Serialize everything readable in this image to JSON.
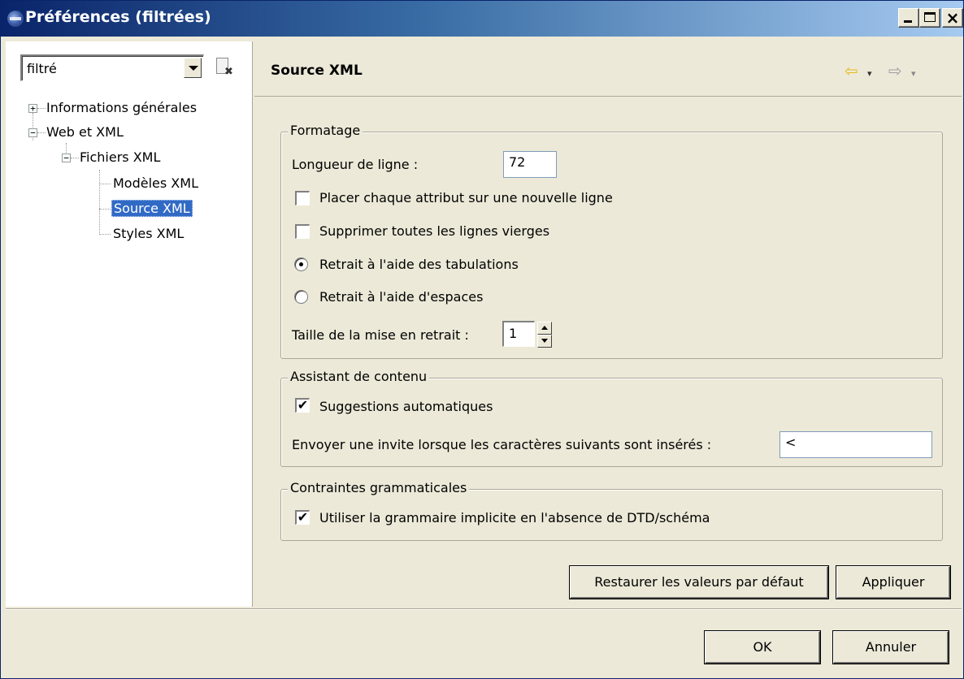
{
  "window": {
    "title": "Préférences (filtrées)",
    "controls": {
      "minimize": "_",
      "maximize": "□",
      "close": "×"
    }
  },
  "filter": {
    "value": "filtré"
  },
  "tree": {
    "items": [
      {
        "label": "Informations générales",
        "expander": "+"
      },
      {
        "label": "Web et XML",
        "expander": "−"
      },
      {
        "label": "Fichiers XML",
        "expander": "−"
      },
      {
        "label": "Modèles XML"
      },
      {
        "label": "Source XML",
        "selected": true
      },
      {
        "label": "Styles XML"
      }
    ]
  },
  "page": {
    "title": "Source XML",
    "nav": {
      "back": "⇦",
      "dropdown": "▾",
      "forward": "⇨"
    }
  },
  "formatting": {
    "legend": "Formatage",
    "line_length_label": "Longueur de ligne :",
    "line_length_value": "72",
    "attr_newline_label": "Placer chaque attribut sur une nouvelle ligne",
    "attr_newline_checked": false,
    "remove_blank_label": "Supprimer toutes les lignes vierges",
    "remove_blank_checked": false,
    "indent_tabs_label": "Retrait à l'aide des tabulations",
    "indent_tabs_selected": true,
    "indent_spaces_label": "Retrait à l'aide d'espaces",
    "indent_spaces_selected": false,
    "indent_size_label": "Taille de la mise en retrait :",
    "indent_size_value": "1"
  },
  "content_assist": {
    "legend": "Assistant de contenu",
    "auto_suggest_label": "Suggestions automatiques",
    "auto_suggest_checked": true,
    "prompt_label": "Envoyer une invite lorsque les caractères suivants sont insérés :",
    "prompt_value": "<"
  },
  "grammar": {
    "legend": "Contraintes grammaticales",
    "implicit_label": "Utiliser la grammaire implicite en l'absence de DTD/schéma",
    "implicit_checked": true
  },
  "actions": {
    "restore_defaults": "Restaurer les valeurs par défaut",
    "apply": "Appliquer",
    "ok": "OK",
    "cancel": "Annuler"
  },
  "colors": {
    "titlebar_start": "#0a246a",
    "titlebar_end": "#a6caf0",
    "dialog_bg": "#ece9d8",
    "selection": "#316ac5"
  }
}
